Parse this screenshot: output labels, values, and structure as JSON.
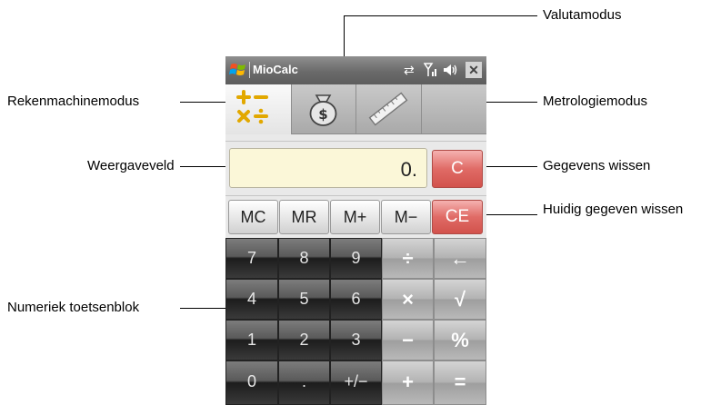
{
  "callouts": {
    "valutamodus": "Valutamodus",
    "rekenmachinemodus": "Rekenmachinemodus",
    "metrologiemodus": "Metrologiemodus",
    "weergaveveld": "Weergaveveld",
    "gegevens_wissen": "Gegevens wissen",
    "huidig_gegeven_wissen": "Huidig gegeven wissen",
    "numeriek_toetsenblok": "Numeriek toetsenblok"
  },
  "titlebar": {
    "app_title": "MioCalc",
    "icons": [
      "windows-logo",
      "sync-icon",
      "signal-icon",
      "volume-icon",
      "close-icon"
    ],
    "close_label": "✕"
  },
  "tabs": [
    {
      "name": "calculator",
      "icon": "calculator-icon",
      "active": true
    },
    {
      "name": "currency",
      "icon": "money-bag-icon",
      "active": false
    },
    {
      "name": "metrology",
      "icon": "ruler-icon",
      "active": false
    }
  ],
  "display": {
    "value": "0."
  },
  "keys": {
    "clear": "C",
    "clear_entry": "CE",
    "memory": [
      "MC",
      "MR",
      "M+",
      "M−"
    ],
    "rows": [
      [
        "7",
        "8",
        "9",
        "÷",
        "←"
      ],
      [
        "4",
        "5",
        "6",
        "×",
        "√"
      ],
      [
        "1",
        "2",
        "3",
        "−",
        "%"
      ],
      [
        "0",
        ".",
        "+/−",
        "+",
        "="
      ]
    ]
  },
  "colors": {
    "accent_red": "#d9605a",
    "display_bg": "#fbf7d8",
    "titlebar": "#6a6a6a"
  }
}
